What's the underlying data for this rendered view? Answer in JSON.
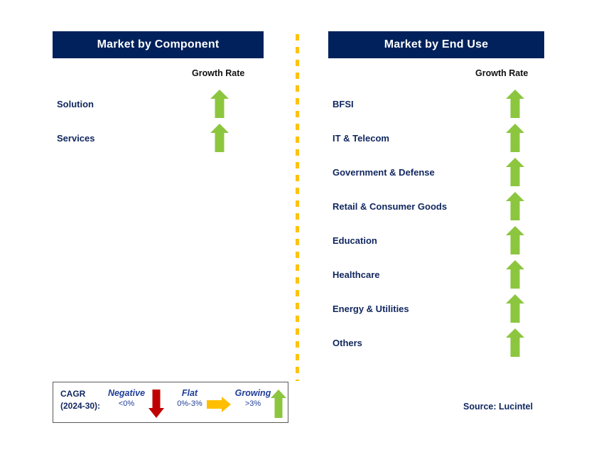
{
  "panels": [
    {
      "id": "component",
      "title": "Market by Component",
      "growth_header": "Growth Rate",
      "rows": [
        {
          "label": "Solution",
          "growth": "growing",
          "arrow": "up-arrow-icon"
        },
        {
          "label": "Services",
          "growth": "growing",
          "arrow": "up-arrow-icon"
        }
      ]
    },
    {
      "id": "end-use",
      "title": "Market by End Use",
      "growth_header": "Growth Rate",
      "rows": [
        {
          "label": "BFSI",
          "growth": "growing",
          "arrow": "up-arrow-icon"
        },
        {
          "label": "IT & Telecom",
          "growth": "growing",
          "arrow": "up-arrow-icon"
        },
        {
          "label": "Government & Defense",
          "growth": "growing",
          "arrow": "up-arrow-icon"
        },
        {
          "label": "Retail & Consumer Goods",
          "growth": "growing",
          "arrow": "up-arrow-icon"
        },
        {
          "label": "Education",
          "growth": "growing",
          "arrow": "up-arrow-icon"
        },
        {
          "label": "Healthcare",
          "growth": "growing",
          "arrow": "up-arrow-icon"
        },
        {
          "label": "Energy & Utilities",
          "growth": "growing",
          "arrow": "up-arrow-icon"
        },
        {
          "label": "Others",
          "growth": "growing",
          "arrow": "up-arrow-icon"
        }
      ]
    }
  ],
  "legend": {
    "cagr_line1": "CAGR",
    "cagr_line2": "(2024-30):",
    "entries": [
      {
        "title": "Negative",
        "value": "<0%",
        "icon": "down-arrow-icon",
        "color": "#c00000"
      },
      {
        "title": "Flat",
        "value": "0%-3%",
        "icon": "right-arrow-icon",
        "color": "#ffbf00"
      },
      {
        "title": "Growing",
        "value": ">3%",
        "icon": "up-arrow-icon",
        "color": "#8cc63f"
      }
    ]
  },
  "source": "Source: Lucintel",
  "colors": {
    "header_navy": "#00215b",
    "label_navy": "#10265e",
    "growing_green": "#8cc63f",
    "negative_red": "#c00000",
    "flat_amber": "#ffbf00",
    "divider_amber": "#ffc20e",
    "legend_text_blue": "#1f3d99"
  }
}
